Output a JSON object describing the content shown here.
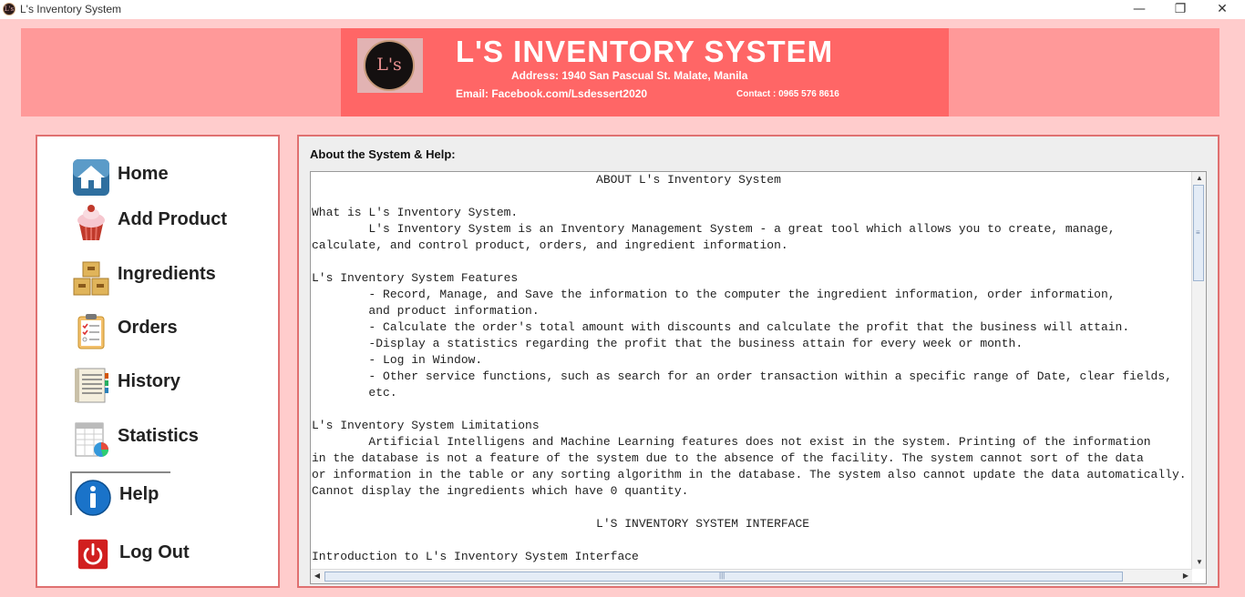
{
  "window": {
    "title": "L's Inventory System",
    "icon_text": "L's",
    "controls": {
      "minimize": "—",
      "maximize": "❐",
      "close": "✕"
    }
  },
  "banner": {
    "logo_text": "L's",
    "title": "L'S INVENTORY SYSTEM",
    "address": "Address: 1940 San Pascual St. Malate, Manila",
    "email": "Email: Facebook.com/Lsdessert2020",
    "contact": "Contact : 0965 576 8616"
  },
  "colors": {
    "background": "#ffcccc",
    "header_band": "#ff9999",
    "banner": "#ff6666",
    "panel_border": "#e07070"
  },
  "sidebar": {
    "items": [
      {
        "label": "Home",
        "icon": "home-icon"
      },
      {
        "label": "Add Product",
        "icon": "cupcake-icon"
      },
      {
        "label": "Ingredients",
        "icon": "boxes-icon"
      },
      {
        "label": "Orders",
        "icon": "clipboard-icon"
      },
      {
        "label": "History",
        "icon": "notebook-icon"
      },
      {
        "label": "Statistics",
        "icon": "spreadsheet-chart-icon"
      },
      {
        "label": "Help",
        "icon": "info-icon",
        "selected": true
      },
      {
        "label": "Log Out",
        "icon": "power-icon"
      }
    ]
  },
  "main": {
    "heading": "About the System & Help:",
    "text_lines": [
      "                                        ABOUT L's Inventory System",
      "",
      "What is L's Inventory System.",
      "        L's Inventory System is an Inventory Management System - a great tool which allows you to create, manage,",
      "calculate, and control product, orders, and ingredient information.",
      "",
      "L's Inventory System Features",
      "        - Record, Manage, and Save the information to the computer the ingredient information, order information,",
      "        and product information.",
      "        - Calculate the order's total amount with discounts and calculate the profit that the business will attain.",
      "        -Display a statistics regarding the profit that the business attain for every week or month.",
      "        - Log in Window.",
      "        - Other service functions, such as search for an order transaction within a specific range of Date, clear fields,",
      "        etc.",
      "",
      "L's Inventory System Limitations",
      "        Artificial Intelligens and Machine Learning features does not exist in the system. Printing of the information",
      "in the database is not a feature of the system due to the absence of the facility. The system cannot sort of the data",
      "or information in the table or any sorting algorithm in the database. The system also cannot update the data automatically.",
      "Cannot display the ingredients which have 0 quantity.",
      "",
      "                                        L'S INVENTORY SYSTEM INTERFACE",
      "",
      "Introduction to L's Inventory System Interface"
    ]
  }
}
